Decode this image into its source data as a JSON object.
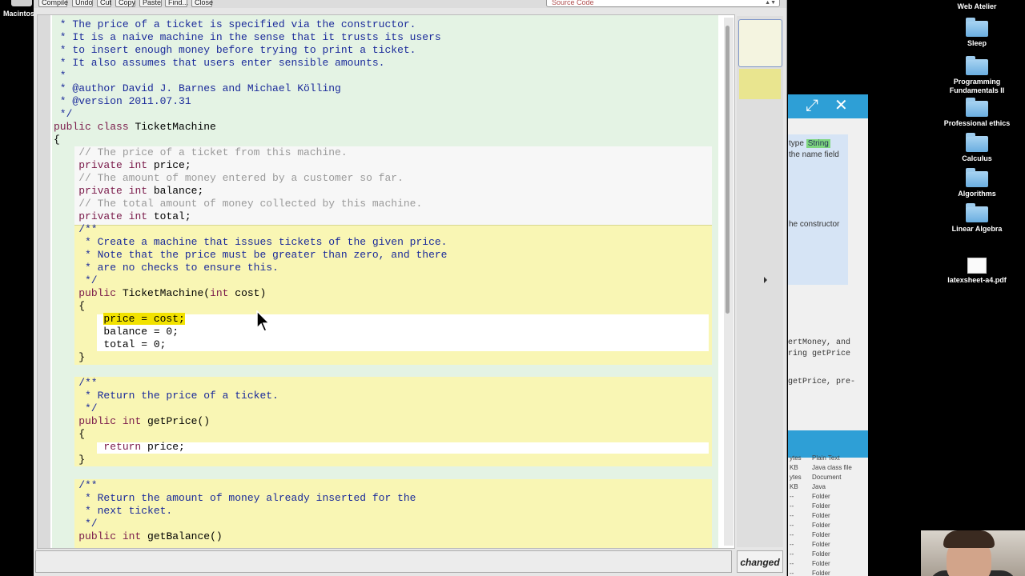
{
  "desktop": {
    "mac_label": "Macintos",
    "icons": [
      {
        "label": "Web Atelier",
        "kind": "folder"
      },
      {
        "label": "Sleep",
        "kind": "folder"
      },
      {
        "label": "Programming Fundamentals II",
        "kind": "folder"
      },
      {
        "label": "Professional ethics",
        "kind": "folder"
      },
      {
        "label": "Calculus",
        "kind": "folder"
      },
      {
        "label": "Algorithms",
        "kind": "folder"
      },
      {
        "label": "Linear Algebra",
        "kind": "folder"
      },
      {
        "label": "latexsheet-a4.pdf",
        "kind": "document"
      }
    ]
  },
  "editor": {
    "toolbar": {
      "compile": "Compile",
      "undo": "Undo",
      "cut": "Cut",
      "copy": "Copy",
      "paste": "Paste",
      "find": "Find...",
      "close": "Close",
      "view_select": "Source Code"
    },
    "code_lines": [
      " * The price of a ticket is specified via the constructor.",
      " * It is a naive machine in the sense that it trusts its users",
      " * to insert enough money before trying to print a ticket.",
      " * It also assumes that users enter sensible amounts.",
      " *",
      " * @author David J. Barnes and Michael Kölling",
      " * @version 2011.07.31",
      " */",
      "public class TicketMachine",
      "{",
      "    // The price of a ticket from this machine.",
      "    private int price;",
      "    // The amount of money entered by a customer so far.",
      "    private int balance;",
      "    // The total amount of money collected by this machine.",
      "    private int total;",
      "    /**",
      "     * Create a machine that issues tickets of the given price.",
      "     * Note that the price must be greater than zero, and there",
      "     * are no checks to ensure this.",
      "     */",
      "    public TicketMachine(int cost)",
      "    {",
      "        price = cost;",
      "        balance = 0;",
      "        total = 0;",
      "    }",
      "",
      "    /**",
      "     * Return the price of a ticket.",
      "     */",
      "    public int getPrice()",
      "    {",
      "        return price;",
      "    }",
      "",
      "    /**",
      "     * Return the amount of money already inserted for the",
      "     * next ticket.",
      "     */",
      "    public int getBalance()"
    ],
    "highlighted_text": "price = cost;",
    "status": "changed"
  },
  "background_window": {
    "text_type_prefix": "type ",
    "text_type_string": "String",
    "text_name_field": "the name field",
    "text_constructor": "he constructor",
    "text_insert": "ertMoney, and",
    "text_getprice": "ring getPrice",
    "text_pre": "getPrice, pre-",
    "files": [
      {
        "size": "ytes",
        "kind": "Plain Text"
      },
      {
        "size": "KB",
        "kind": "Java class file"
      },
      {
        "size": "ytes",
        "kind": "Document"
      },
      {
        "size": "KB",
        "kind": "Java"
      },
      {
        "size": "--",
        "kind": "Folder"
      },
      {
        "size": "--",
        "kind": "Folder"
      },
      {
        "size": "--",
        "kind": "Folder"
      },
      {
        "size": "--",
        "kind": "Folder"
      },
      {
        "size": "--",
        "kind": "Folder"
      },
      {
        "size": "--",
        "kind": "Folder"
      },
      {
        "size": "--",
        "kind": "Folder"
      },
      {
        "size": "--",
        "kind": "Folder"
      },
      {
        "size": "--",
        "kind": "Folder"
      }
    ]
  }
}
